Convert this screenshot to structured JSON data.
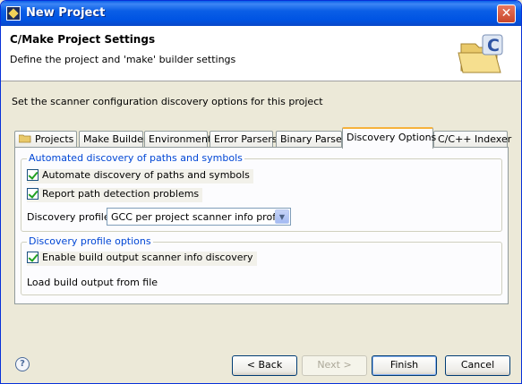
{
  "window": {
    "title": "New Project"
  },
  "header": {
    "title": "C/Make Project Settings",
    "description": "Define the project and 'make' builder settings"
  },
  "instruction": "Set the scanner configuration discovery options for this project",
  "tabs": [
    {
      "label": "Projects"
    },
    {
      "label": "Make Builder"
    },
    {
      "label": "Environment"
    },
    {
      "label": "Error Parsers"
    },
    {
      "label": "Binary Parser"
    },
    {
      "label": "Discovery Options",
      "active": true
    },
    {
      "label": "C/C++ Indexer"
    }
  ],
  "automated_group": {
    "label": "Automated discovery of paths and symbols",
    "checkboxes": [
      {
        "label": "Automate discovery of paths and symbols",
        "checked": true
      },
      {
        "label": "Report path detection problems",
        "checked": true
      }
    ],
    "profile_label": "Discovery profile:",
    "profile_value": "GCC per project scanner info profile"
  },
  "profile_options_group": {
    "label": "Discovery profile options",
    "checkbox": {
      "label": "Enable build output scanner info discovery",
      "checked": true
    },
    "load_label": "Load build output from file"
  },
  "buttons": {
    "back": "< Back",
    "next": "Next >",
    "finish": "Finish",
    "cancel": "Cancel"
  },
  "icons": {
    "app": "eclipse-icon",
    "close": "close-icon",
    "banner": "c-folder-icon",
    "help": "help-icon"
  },
  "colors": {
    "titlebar": "#0054e3",
    "group_label": "#0046d5",
    "tab_active_accent": "#f6b23c"
  }
}
